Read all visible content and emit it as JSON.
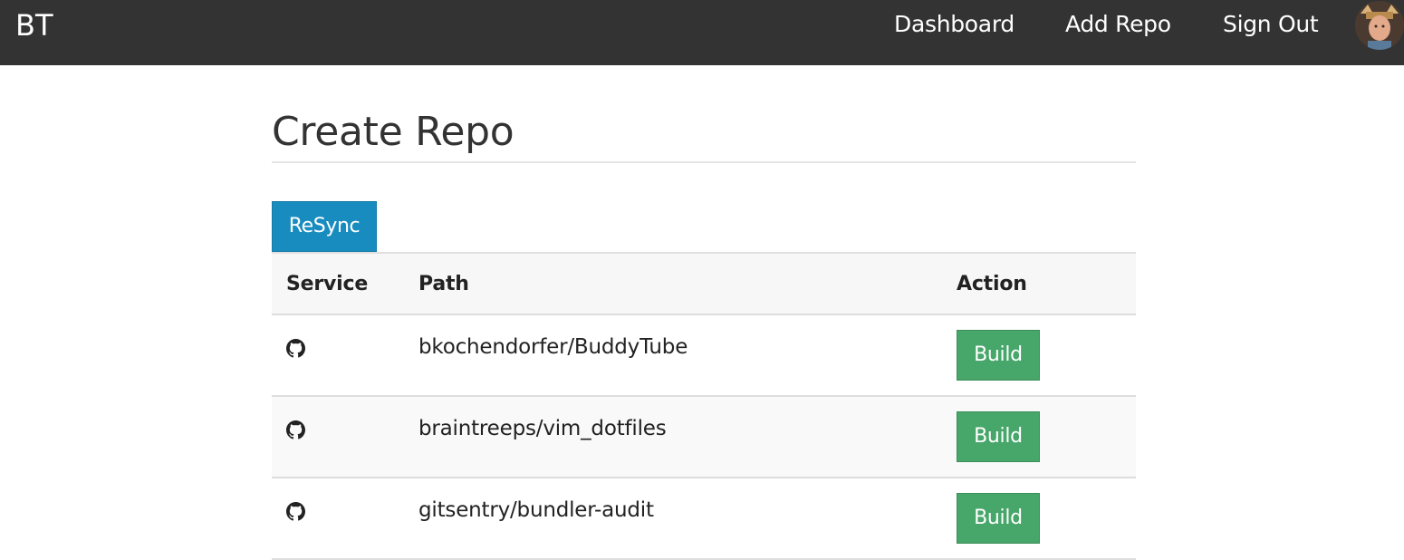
{
  "navbar": {
    "brand": "BT",
    "links": {
      "dashboard": "Dashboard",
      "add_repo": "Add Repo",
      "sign_out": "Sign Out"
    },
    "avatar_icon": "user-avatar"
  },
  "page": {
    "title": "Create Repo"
  },
  "toolbar": {
    "resync_label": "ReSync"
  },
  "table": {
    "headers": {
      "service": "Service",
      "path": "Path",
      "action": "Action"
    },
    "rows": [
      {
        "service_icon": "github-icon",
        "path": "bkochendorfer/BuddyTube",
        "action_label": "Build"
      },
      {
        "service_icon": "github-icon",
        "path": "braintreeps/vim_dotfiles",
        "action_label": "Build"
      },
      {
        "service_icon": "github-icon",
        "path": "gitsentry/bundler-audit",
        "action_label": "Build"
      }
    ]
  },
  "colors": {
    "navbar_bg": "#333333",
    "resync_button": "#198cbf",
    "build_button": "#47a66a",
    "table_header_bg": "#f7f7f7",
    "row_alt_bg": "#f9f9f9"
  }
}
